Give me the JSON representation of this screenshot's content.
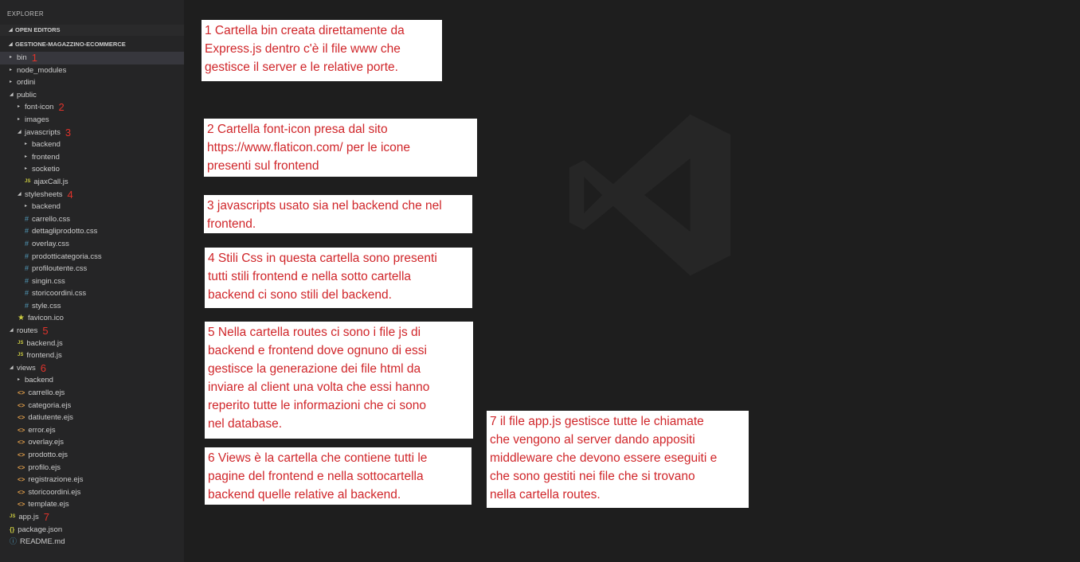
{
  "sidebar": {
    "title": "EXPLORER",
    "open_editors": "OPEN EDITORS",
    "project": "GESTIONE-MAGAZZINO-ECOMMERCE",
    "tree": [
      {
        "label": "bin",
        "depth": 1,
        "kind": "folder-closed",
        "number": "1",
        "selected": true
      },
      {
        "label": "node_modules",
        "depth": 1,
        "kind": "folder-closed"
      },
      {
        "label": "ordini",
        "depth": 1,
        "kind": "folder-closed"
      },
      {
        "label": "public",
        "depth": 1,
        "kind": "folder-open"
      },
      {
        "label": "font-icon",
        "depth": 2,
        "kind": "folder-closed",
        "number": "2"
      },
      {
        "label": "images",
        "depth": 2,
        "kind": "folder-closed"
      },
      {
        "label": "javascripts",
        "depth": 2,
        "kind": "folder-open",
        "number": "3"
      },
      {
        "label": "backend",
        "depth": 3,
        "kind": "folder-closed"
      },
      {
        "label": "frontend",
        "depth": 3,
        "kind": "folder-closed"
      },
      {
        "label": "socketio",
        "depth": 3,
        "kind": "folder-closed"
      },
      {
        "label": "ajaxCall.js",
        "depth": 3,
        "kind": "js"
      },
      {
        "label": "stylesheets",
        "depth": 2,
        "kind": "folder-open",
        "number": "4"
      },
      {
        "label": "backend",
        "depth": 3,
        "kind": "folder-closed"
      },
      {
        "label": "carrello.css",
        "depth": 3,
        "kind": "css"
      },
      {
        "label": "dettagliprodotto.css",
        "depth": 3,
        "kind": "css"
      },
      {
        "label": "overlay.css",
        "depth": 3,
        "kind": "css"
      },
      {
        "label": "prodotticategoria.css",
        "depth": 3,
        "kind": "css"
      },
      {
        "label": "profiloutente.css",
        "depth": 3,
        "kind": "css"
      },
      {
        "label": "singin.css",
        "depth": 3,
        "kind": "css"
      },
      {
        "label": "storicoordini.css",
        "depth": 3,
        "kind": "css"
      },
      {
        "label": "style.css",
        "depth": 3,
        "kind": "css"
      },
      {
        "label": "favicon.ico",
        "depth": 2,
        "kind": "star"
      },
      {
        "label": "routes",
        "depth": 1,
        "kind": "folder-open",
        "number": "5"
      },
      {
        "label": "backend.js",
        "depth": 2,
        "kind": "js"
      },
      {
        "label": "frontend.js",
        "depth": 2,
        "kind": "js"
      },
      {
        "label": "views",
        "depth": 1,
        "kind": "folder-open",
        "number": "6"
      },
      {
        "label": "backend",
        "depth": 2,
        "kind": "folder-closed"
      },
      {
        "label": "carrello.ejs",
        "depth": 2,
        "kind": "ejs"
      },
      {
        "label": "categoria.ejs",
        "depth": 2,
        "kind": "ejs"
      },
      {
        "label": "datiutente.ejs",
        "depth": 2,
        "kind": "ejs"
      },
      {
        "label": "error.ejs",
        "depth": 2,
        "kind": "ejs"
      },
      {
        "label": "overlay.ejs",
        "depth": 2,
        "kind": "ejs"
      },
      {
        "label": "prodotto.ejs",
        "depth": 2,
        "kind": "ejs"
      },
      {
        "label": "profilo.ejs",
        "depth": 2,
        "kind": "ejs"
      },
      {
        "label": "registrazione.ejs",
        "depth": 2,
        "kind": "ejs"
      },
      {
        "label": "storicoordini.ejs",
        "depth": 2,
        "kind": "ejs"
      },
      {
        "label": "template.ejs",
        "depth": 2,
        "kind": "ejs"
      },
      {
        "label": "app.js",
        "depth": 1,
        "kind": "js",
        "number": "7"
      },
      {
        "label": "package.json",
        "depth": 1,
        "kind": "json"
      },
      {
        "label": "README.md",
        "depth": 1,
        "kind": "info"
      }
    ]
  },
  "icons": {
    "folder-closed": "▸",
    "folder-open": "◢",
    "js": "JS",
    "css": "#",
    "ejs": "<>",
    "star": "★",
    "json": "{}",
    "info": "ⓘ"
  },
  "colors": {
    "sidebar_bg": "#252526",
    "editor_bg": "#1e1e1e",
    "annotation_red": "#d0262a",
    "number_red": "#e0332b"
  },
  "notes": {
    "n1": [
      "1 Cartella bin creata direttamente da",
      "Express.js dentro c'è il file www che",
      "gestisce il server e le relative porte."
    ],
    "n2": [
      "2 Cartella font-icon presa dal sito",
      "https://www.flaticon.com/ per le icone",
      "presenti sul frontend"
    ],
    "n3": [
      "3 javascripts usato sia nel backend che nel",
      "frontend."
    ],
    "n4": [
      "4 Stili Css in questa cartella sono presenti",
      "tutti stili frontend e nella sotto cartella",
      "backend ci sono stili del backend."
    ],
    "n5": [
      "5 Nella cartella routes ci sono i file js di",
      "backend e frontend dove ognuno di essi",
      "gestisce la generazione dei file html da",
      "inviare al client una volta che essi hanno",
      "reperito tutte le informazioni che ci sono",
      "nel database."
    ],
    "n6": [
      "6 Views è la cartella che contiene tutti le",
      "pagine del frontend e nella sottocartella",
      "backend quelle relative al backend."
    ],
    "n7": [
      "7 il file app.js gestisce tutte le chiamate",
      "che vengono al server dando appositi",
      "middleware che devono essere eseguiti e",
      "che sono gestiti nei file che si trovano",
      "nella cartella routes."
    ]
  }
}
